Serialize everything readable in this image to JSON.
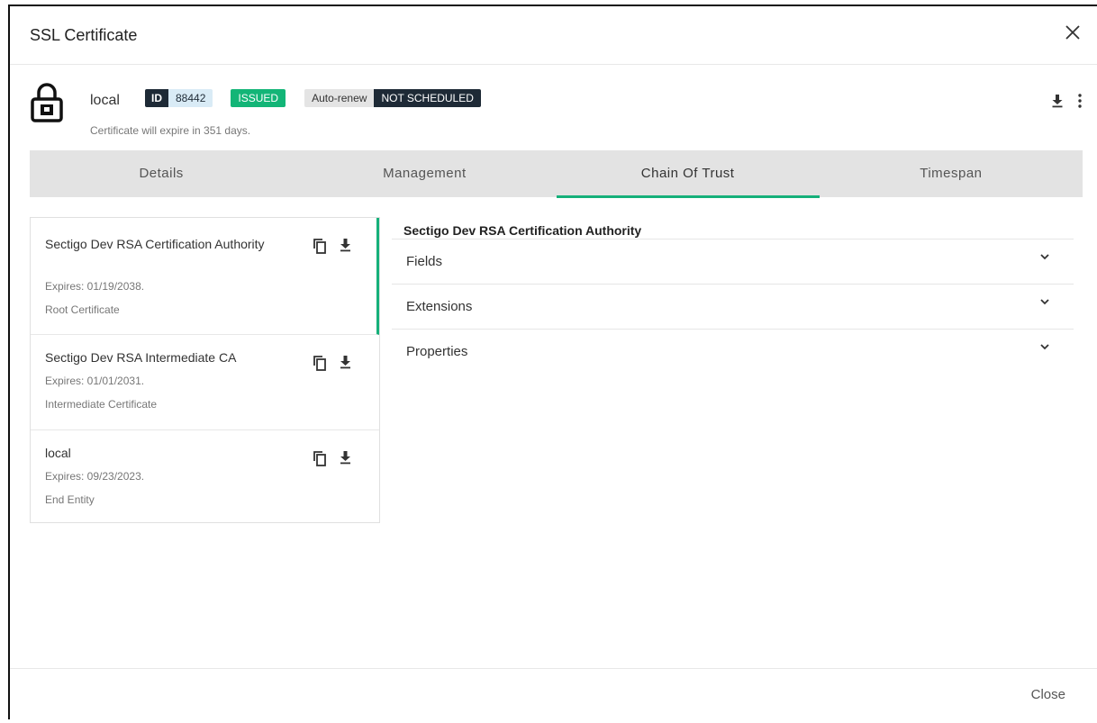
{
  "dialog": {
    "title": "SSL Certificate",
    "close_label": "Close"
  },
  "certificate": {
    "name": "local",
    "id_label": "ID",
    "id_value": "88442",
    "status": "ISSUED",
    "auto_renew_label": "Auto-renew",
    "auto_renew_value": "NOT SCHEDULED",
    "expiry_text": "Certificate will expire in 351 days."
  },
  "tabs": [
    {
      "label": "Details",
      "active": false
    },
    {
      "label": "Management",
      "active": false
    },
    {
      "label": "Chain Of Trust",
      "active": true
    },
    {
      "label": "Timespan",
      "active": false
    }
  ],
  "chain": [
    {
      "name": "Sectigo Dev RSA Certification Authority",
      "expires": "Expires: 01/19/2038.",
      "type": "Root Certificate",
      "selected": true
    },
    {
      "name": "Sectigo Dev RSA Intermediate CA",
      "expires": "Expires: 01/01/2031.",
      "type": "Intermediate Certificate",
      "selected": false
    },
    {
      "name": "local",
      "expires": "Expires: 09/23/2023.",
      "type": "End Entity",
      "selected": false
    }
  ],
  "detail": {
    "title": "Sectigo Dev RSA Certification Authority",
    "sections": [
      "Fields",
      "Extensions",
      "Properties"
    ]
  },
  "icons": {
    "lock": "lock-icon",
    "close": "close-icon",
    "download": "download-icon",
    "more": "more-vert-icon",
    "copy": "copy-icon",
    "chevron": "chevron-down-icon"
  },
  "colors": {
    "accent": "#16b07a",
    "issued": "#13b577",
    "dark_badge": "#1e2a36",
    "id_value_bg": "#d9ebf6",
    "tabs_bg": "#e3e3e3"
  }
}
